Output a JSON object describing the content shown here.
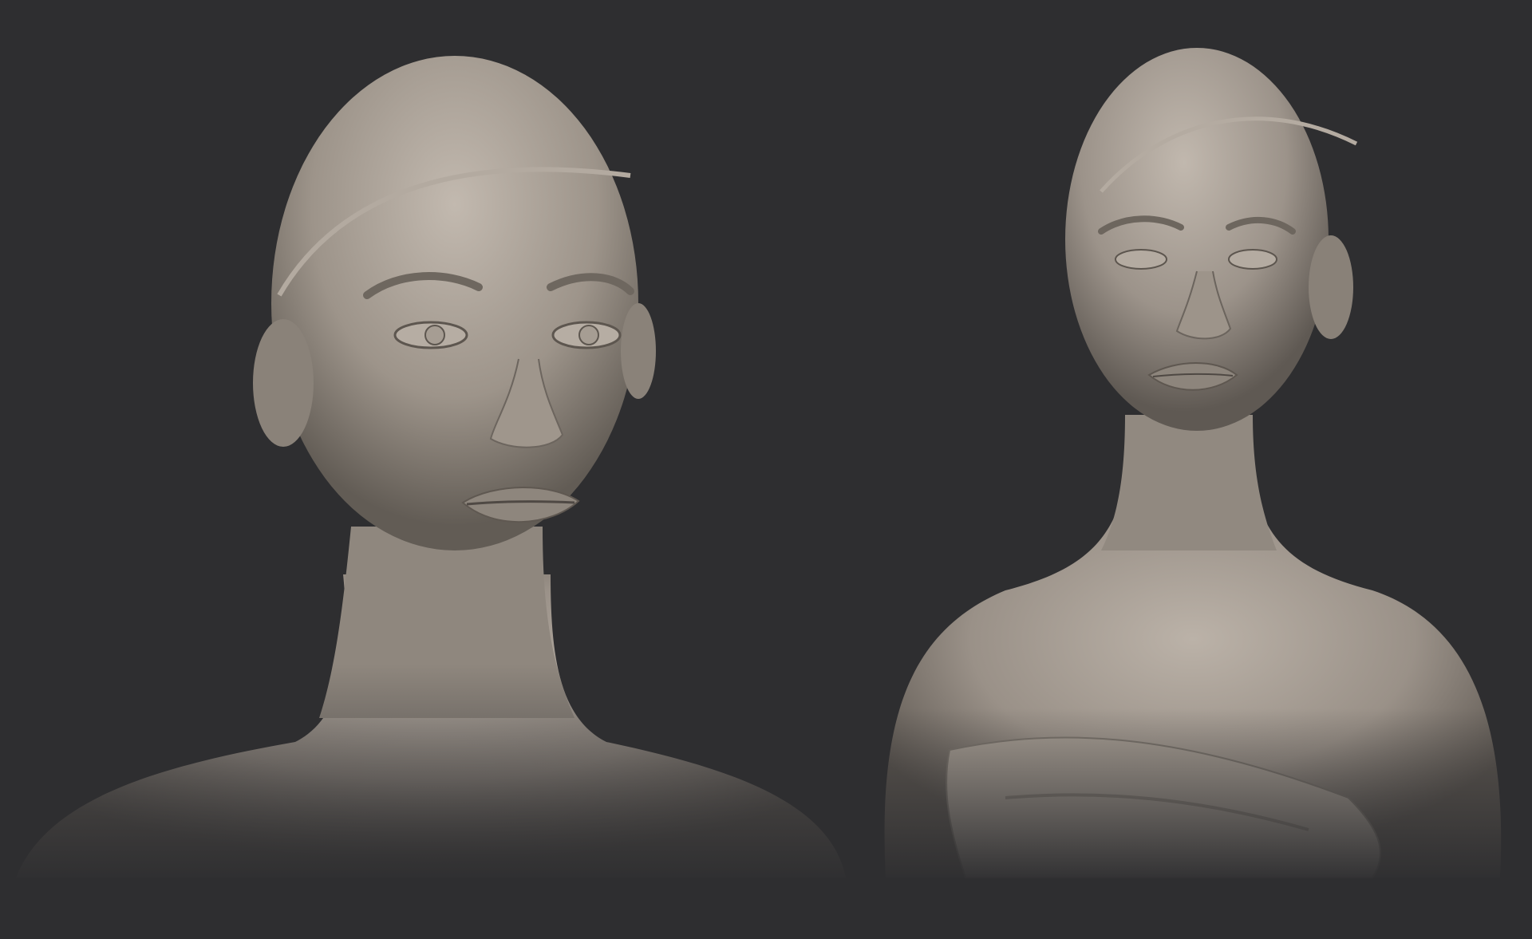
{
  "scene": {
    "description_type": "3d-sculpt-render",
    "background_color": "#2e2e30",
    "material_color": "#a79f96",
    "views": [
      {
        "name": "front-view-closeup"
      },
      {
        "name": "three-quarter-view-bust"
      }
    ]
  }
}
